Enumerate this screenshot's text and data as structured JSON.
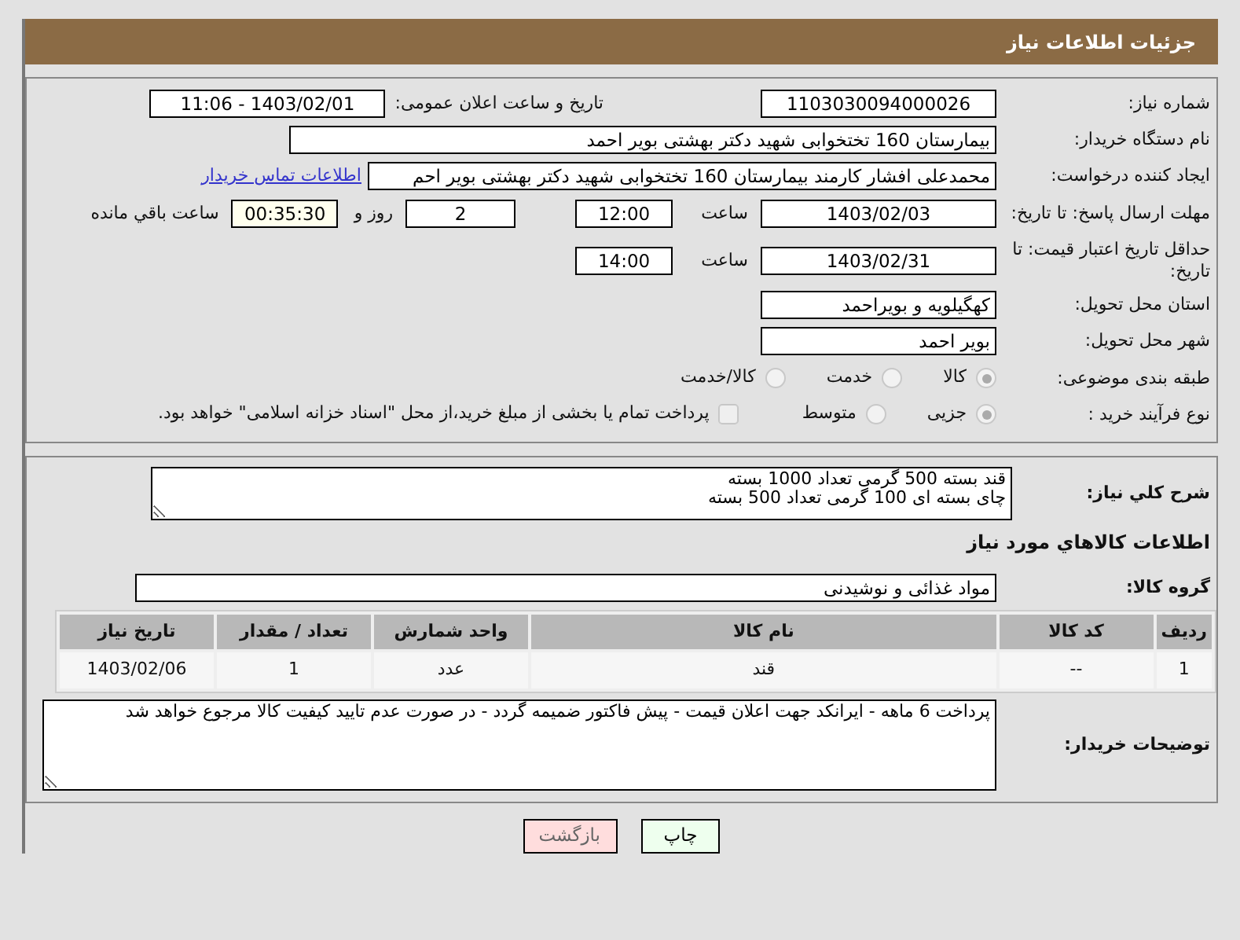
{
  "header": {
    "title": "جزئیات اطلاعات نیاز"
  },
  "need_number": {
    "label": "شماره نیاز:",
    "value": "1103030094000026"
  },
  "announce": {
    "label": "تاریخ و ساعت اعلان عمومی:",
    "value": "1403/02/01 - 11:06"
  },
  "buyer_org": {
    "label": "نام دستگاه خریدار:",
    "value": "بیمارستان 160 تختخوابی شهید دکتر بهشتی بویر احمد"
  },
  "requester": {
    "label": "ایجاد کننده درخواست:",
    "value": "محمدعلی افشار کارمند بیمارستان 160 تختخوابی شهید دکتر بهشتی بویر احم",
    "link": "اطلاعات تماس خریدار"
  },
  "deadline": {
    "label": "مهلت ارسال پاسخ: تا تاریخ:",
    "date": "1403/02/03",
    "time_label": "ساعت",
    "time": "12:00",
    "days": "2",
    "days_label": "روز و",
    "remaining": "00:35:30",
    "remaining_label": "ساعت باقي مانده"
  },
  "validity": {
    "label": "حداقل تاریخ اعتبار قیمت: تا تاریخ:",
    "date": "1403/02/31",
    "time_label": "ساعت",
    "time": "14:00"
  },
  "province": {
    "label": "استان محل تحویل:",
    "value": "کهگیلویه و بویراحمد"
  },
  "city": {
    "label": "شهر محل تحویل:",
    "value": "بویر احمد"
  },
  "category": {
    "label": "طبقه بندی موضوعی:",
    "options": [
      {
        "label": "کالا",
        "selected": true
      },
      {
        "label": "خدمت",
        "selected": false
      },
      {
        "label": "کالا/خدمت",
        "selected": false
      }
    ]
  },
  "process": {
    "label": "نوع فرآیند خرید :",
    "options": [
      {
        "label": "جزیی",
        "selected": true
      },
      {
        "label": "متوسط",
        "selected": false
      }
    ],
    "checkbox": {
      "checked": false,
      "label": "پرداخت تمام یا بخشی از مبلغ خرید،از محل \"اسناد خزانه اسلامی\" خواهد بود."
    }
  },
  "description": {
    "label": "شرح کلي نياز:",
    "lines": [
      "قند بسته 500 گرمی تعداد 1000 بسته",
      "چای بسته ای 100 گرمی تعداد 500 بسته"
    ]
  },
  "goods_heading": "اطلاعات کالاهاي مورد نياز",
  "goods_group": {
    "label": "گروه کالا:",
    "value": "مواد غذائی و نوشیدنی"
  },
  "table": {
    "columns": [
      "رديف",
      "کد کالا",
      "نام کالا",
      "واحد شمارش",
      "تعداد / مقدار",
      "تاریخ نیاز"
    ],
    "rows": [
      [
        "1",
        "--",
        "قند",
        "عدد",
        "1",
        "1403/02/06"
      ]
    ]
  },
  "buyer_notes": {
    "label": "توضیحات خریدار:",
    "value": "پرداخت 6 ماهه - ایرانکد جهت اعلان قیمت - پیش فاکتور ضمیمه گردد - در صورت عدم تایید کیفیت کالا مرجوع خواهد شد"
  },
  "buttons": [
    {
      "label": "چاپ",
      "kind": "print"
    },
    {
      "label": "بازگشت",
      "kind": "back"
    }
  ]
}
